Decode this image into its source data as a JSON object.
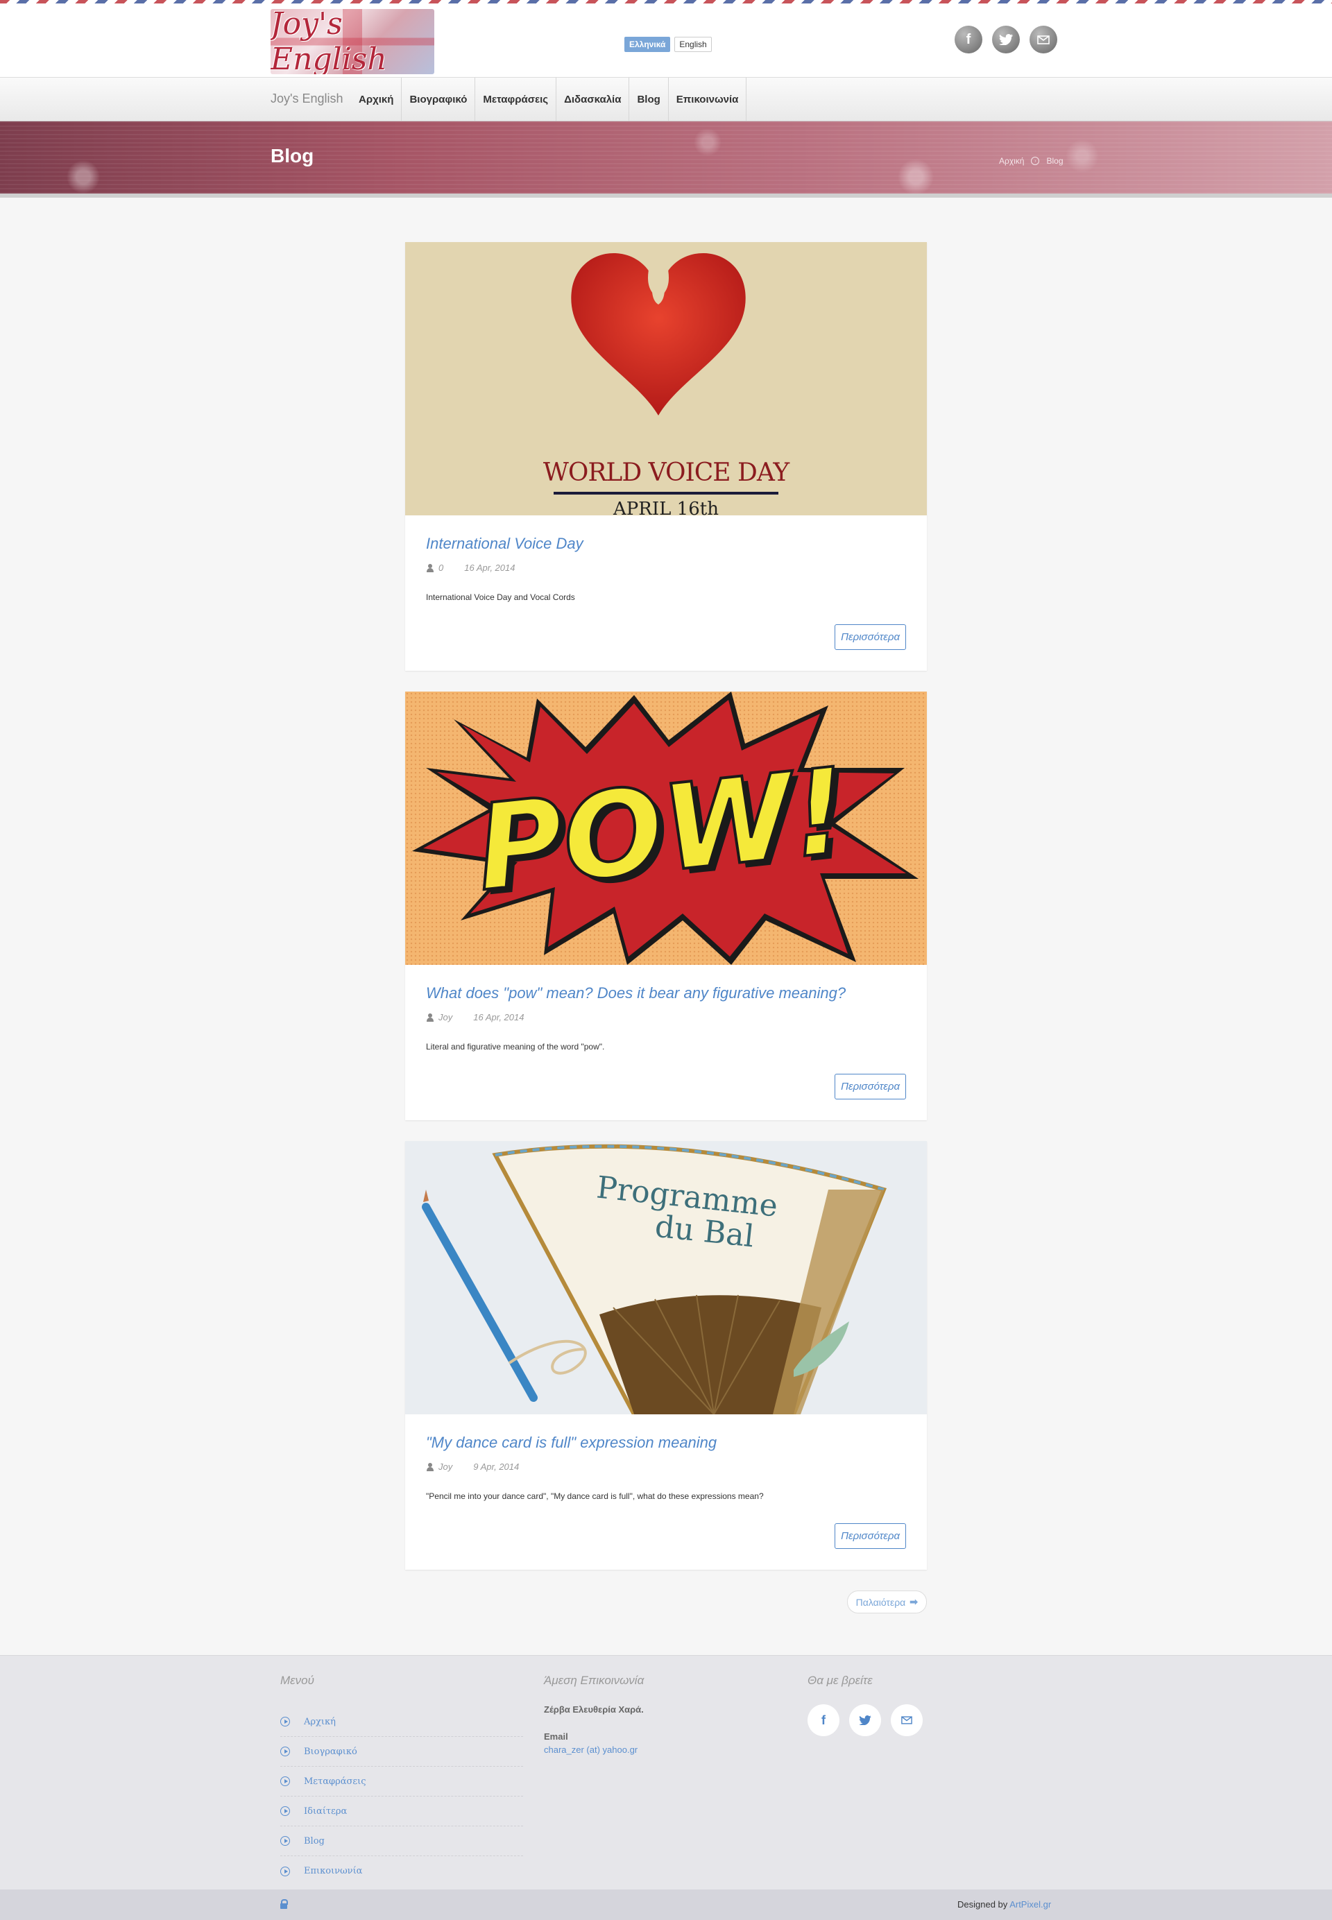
{
  "header": {
    "logo_text": "Joy's English",
    "languages": [
      "Ελληνικά",
      "English"
    ],
    "social": [
      "facebook-icon",
      "twitter-icon",
      "mail-icon"
    ]
  },
  "nav": {
    "brand": "Joy's English",
    "items": [
      "Αρχική",
      "Βιογραφικό",
      "Μεταφράσεις",
      "Διδασκαλία",
      "Blog",
      "Επικοινωνία"
    ]
  },
  "hero": {
    "title": "Blog",
    "breadcrumb": [
      "Αρχική",
      "Blog"
    ]
  },
  "posts": [
    {
      "image_text": [
        "WORLD VOICE DAY",
        "APRIL 16th"
      ],
      "title": "International Voice Day",
      "author": "0",
      "date": "16 Apr, 2014",
      "excerpt": "International Voice Day and Vocal Cords",
      "more": "Περισσότερα"
    },
    {
      "image_text": [
        "POW!"
      ],
      "title": "What does \"pow\" mean? Does it bear any figurative meaning?",
      "author": "Joy",
      "date": "16 Apr, 2014",
      "excerpt": "Literal and figurative meaning of the word \"pow\".",
      "more": "Περισσότερα"
    },
    {
      "image_text": [
        "Programme",
        "du Bal"
      ],
      "title": "\"My dance card is full\" expression meaning",
      "author": "Joy",
      "date": "9 Apr, 2014",
      "excerpt": "\"Pencil me into your dance card\", \"My dance card is full\", what do these expressions mean?",
      "more": "Περισσότερα"
    }
  ],
  "pagination": {
    "older": "Παλαιότερα"
  },
  "footer": {
    "menu_title": "Μενού",
    "menu": [
      "Αρχική",
      "Βιογραφικό",
      "Μεταφράσεις",
      "Ιδιαίτερα",
      "Blog",
      "Επικοινωνία"
    ],
    "contact_title": "Άμεση Επικοινωνία",
    "contact_name": "Ζέρβα Ελευθερία Χαρά.",
    "email_label": "Email",
    "email_value": "chara_zer (at) yahoo.gr",
    "find_title": "Θα με βρείτε",
    "social": [
      "facebook-icon",
      "twitter-icon",
      "mail-icon"
    ]
  },
  "bottom": {
    "designed_prefix": "Designed by",
    "designed_link": "ArtPixel.gr"
  },
  "colors": {
    "accent": "#4f86c8",
    "hero": "#a65565"
  }
}
